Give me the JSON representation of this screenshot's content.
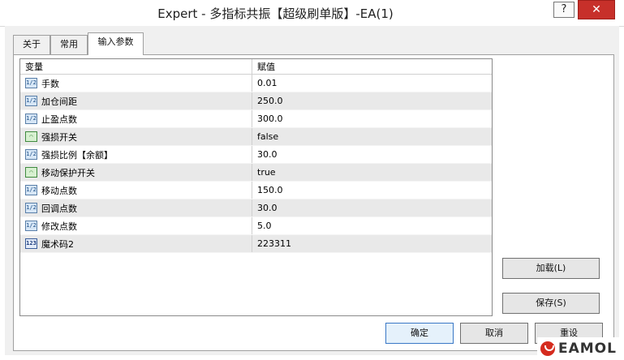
{
  "window": {
    "title": "Expert - 多指标共振【超级刷单版】-EA(1)",
    "help_label": "?",
    "close_label": "✕"
  },
  "tabs": [
    {
      "label": "关于"
    },
    {
      "label": "常用"
    },
    {
      "label": "输入参数"
    }
  ],
  "grid": {
    "headers": {
      "variable": "变量",
      "value": "赋值"
    },
    "rows": [
      {
        "icon": "double-icon",
        "icon_glyph": "1/2",
        "name": "手数",
        "value": "0.01"
      },
      {
        "icon": "double-icon",
        "icon_glyph": "1/2",
        "name": "加仓间距",
        "value": "250.0"
      },
      {
        "icon": "double-icon",
        "icon_glyph": "1/2",
        "name": "止盈点数",
        "value": "300.0"
      },
      {
        "icon": "bool-icon",
        "icon_glyph": "⌒",
        "name": "强损开关",
        "value": "false"
      },
      {
        "icon": "double-icon",
        "icon_glyph": "1/2",
        "name": "强损比例【余额】",
        "value": "30.0"
      },
      {
        "icon": "bool-icon",
        "icon_glyph": "⌒",
        "name": "移动保护开关",
        "value": "true"
      },
      {
        "icon": "double-icon",
        "icon_glyph": "1/2",
        "name": "移动点数",
        "value": "150.0"
      },
      {
        "icon": "double-icon",
        "icon_glyph": "1/2",
        "name": "回调点数",
        "value": "30.0"
      },
      {
        "icon": "double-icon",
        "icon_glyph": "1/2",
        "name": "修改点数",
        "value": "5.0"
      },
      {
        "icon": "int-icon",
        "icon_glyph": "123",
        "name": "魔术码2",
        "value": "223311"
      }
    ]
  },
  "buttons": {
    "load": "加载(L)",
    "save": "保存(S)",
    "ok": "确定",
    "cancel": "取消",
    "reset": "重设"
  },
  "watermark": {
    "text": "EAMOL",
    "color": "#d52b1e"
  }
}
